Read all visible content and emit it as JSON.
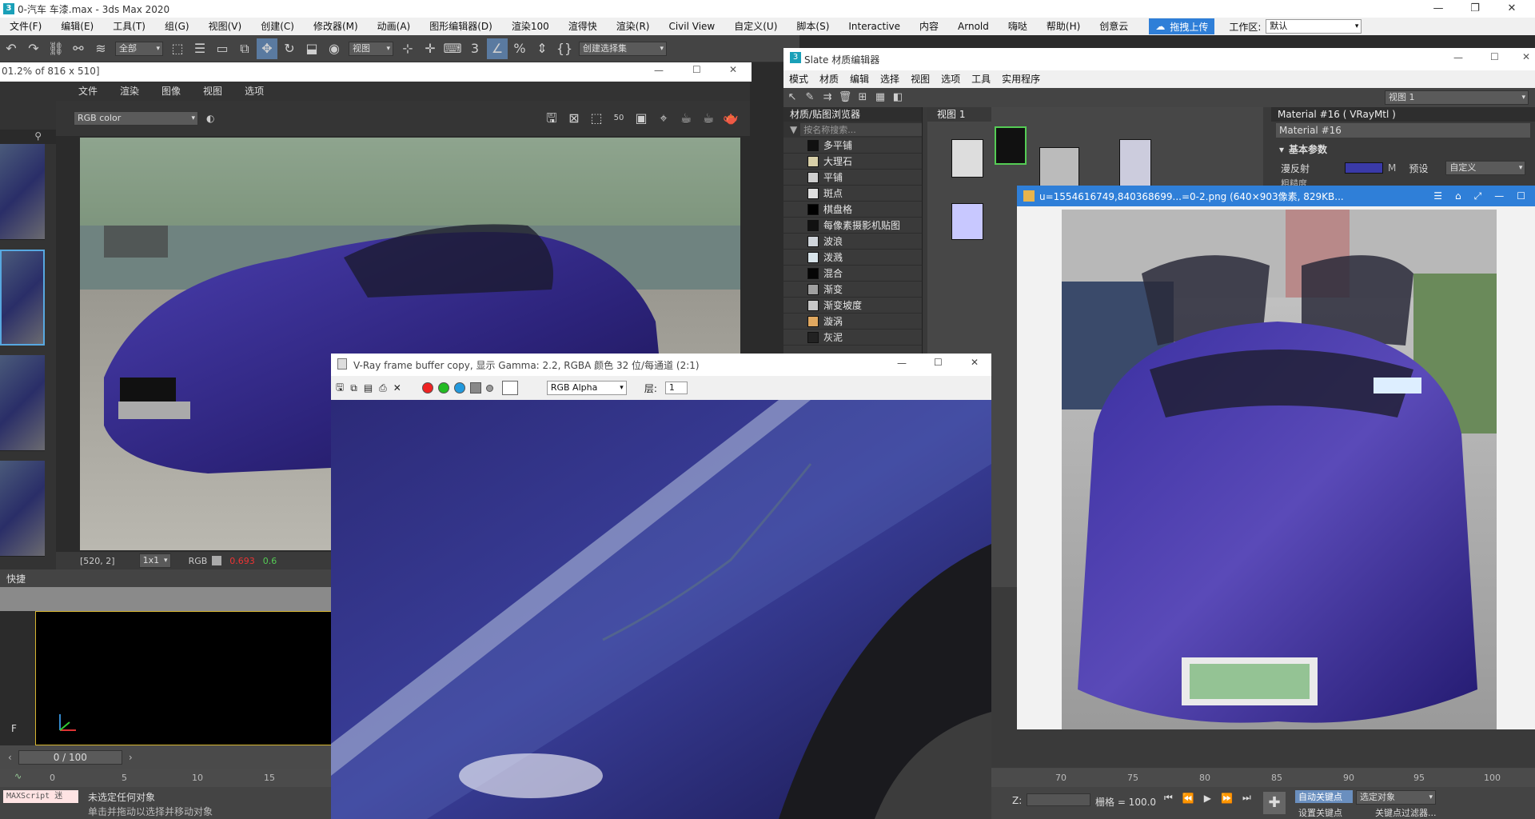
{
  "app": {
    "title": "0-汽车 车漆.max - 3ds Max 2020",
    "menu": [
      "文件(F)",
      "编辑(E)",
      "工具(T)",
      "组(G)",
      "视图(V)",
      "创建(C)",
      "修改器(M)",
      "动画(A)",
      "图形编辑器(D)",
      "渲染100",
      "渲得快",
      "渲染(R)",
      "Civil View",
      "自定义(U)",
      "脚本(S)",
      "Interactive",
      "内容",
      "Arnold",
      "嗨哒",
      "帮助(H)",
      "创意云"
    ],
    "upload_label": "拖拽上传",
    "workspace_label": "工作区:",
    "workspace_value": "默认",
    "toolbar": {
      "filter_value": "全部",
      "view_value": "视图",
      "selection_set": "创建选择集"
    }
  },
  "fb1": {
    "title": "01.2% of 816 x 510]",
    "menu": [
      "文件",
      "渲染",
      "图像",
      "视图",
      "选项"
    ],
    "channel": "RGB color",
    "status": {
      "coords": "[520, 2]",
      "zoom": "1x1",
      "mode": "RGB",
      "r": "0.693",
      "g": "0.6"
    }
  },
  "bottom": {
    "quick_label": "快捷",
    "frame_counter": "0 / 100",
    "ticks": [
      "0",
      "5",
      "10",
      "15",
      "70",
      "75",
      "80",
      "85",
      "90",
      "95",
      "100"
    ],
    "no_selection": "未选定任何对象",
    "maxscript": "MAXScript 迷",
    "hint": "单击并拖动以选择并移动对象",
    "z_label": "Z:",
    "grid_label": "栅格 = 100.0",
    "auto_key": "自动关键点",
    "selected_obj": "选定对象",
    "set_key": "设置关键点",
    "key_filter": "关键点过滤器..."
  },
  "slate": {
    "title": "Slate 材质编辑器",
    "menu": [
      "模式",
      "材质",
      "编辑",
      "选择",
      "视图",
      "选项",
      "工具",
      "实用程序"
    ],
    "view_dropdown": "视图 1",
    "browser_title": "材质/贴图浏览器",
    "search_placeholder": "按名称搜索...",
    "view_tab": "视图 1",
    "maps": [
      {
        "name": "多平铺",
        "color": "#111111"
      },
      {
        "name": "大理石",
        "color": "#d8cfa8"
      },
      {
        "name": "平铺",
        "color": "#cfcfcf"
      },
      {
        "name": "斑点",
        "color": "#e0e0e0"
      },
      {
        "name": "棋盘格",
        "color": "#000000"
      },
      {
        "name": "每像素摄影机贴图",
        "color": "#111111"
      },
      {
        "name": "波浪",
        "color": "#cfd4da"
      },
      {
        "name": "泼溅",
        "color": "#d8e4ea"
      },
      {
        "name": "混合",
        "color": "#050505"
      },
      {
        "name": "渐变",
        "color": "#a0a0a0"
      },
      {
        "name": "渐变坡度",
        "color": "#c8c8c8"
      },
      {
        "name": "漩涡",
        "color": "#e0a860"
      },
      {
        "name": "灰泥",
        "color": "#222222"
      }
    ],
    "material_title": "Material #16 ( VRayMtl )",
    "material_name": "Material #16",
    "rollout": "基本参数",
    "diffuse_label": "漫反射",
    "preset_label": "预设",
    "preset_value": "自定义",
    "rough_label": "粗糙度"
  },
  "viewer": {
    "title": "u=1554616749,840368699...=0-2.png  (640×903像素, 829KB..."
  },
  "vfb": {
    "title": "V-Ray frame buffer copy, 显示 Gamma: 2.2, RGBA 颜色 32 位/每通道 (2:1)",
    "channel": "RGB Alpha",
    "layer_label": "层:",
    "layer_value": "1"
  },
  "colors": {
    "accent_blue": "#2f7fd8",
    "car_purple": "#3b2f8f",
    "diffuse_swatch": "#3a3aa8"
  }
}
